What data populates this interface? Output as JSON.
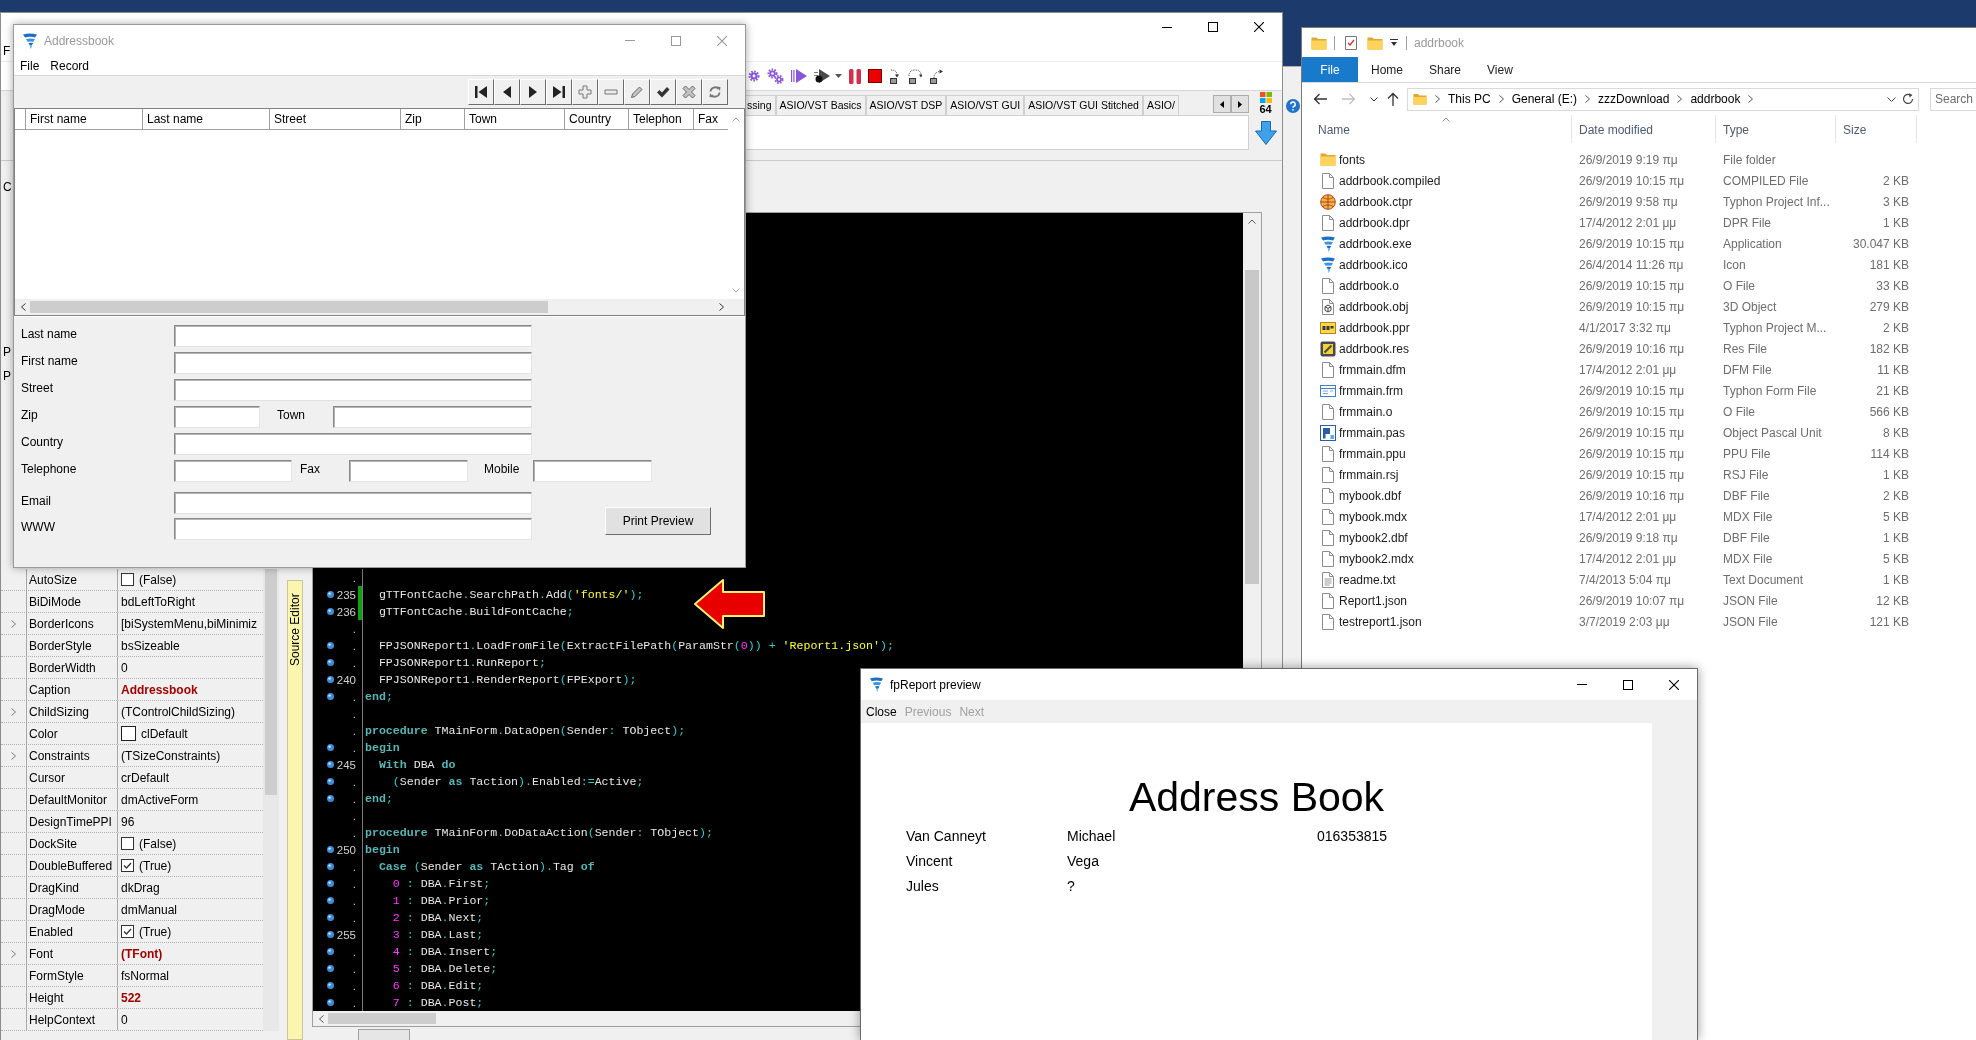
{
  "ide": {
    "menu_fragment": "F",
    "panel_fragments": [
      "C",
      "P",
      "P"
    ],
    "palette_tabs": [
      "ssing",
      "ASIO/VST Basics",
      "ASIO/VST DSP",
      "ASIO/VST GUI",
      "ASIO/VST GUI Stitched",
      "ASIO/"
    ],
    "target_badge": "64",
    "inspector": [
      {
        "name": "AutoSize",
        "value": "(False)",
        "kind": "checkbox",
        "checked": false,
        "expandable": false,
        "modified": false
      },
      {
        "name": "BiDiMode",
        "value": "bdLeftToRight",
        "kind": "text",
        "expandable": false,
        "modified": false
      },
      {
        "name": "BorderIcons",
        "value": "[biSystemMenu,biMinimiz",
        "kind": "text",
        "expandable": true,
        "modified": false
      },
      {
        "name": "BorderStyle",
        "value": "bsSizeable",
        "kind": "text",
        "expandable": false,
        "modified": false
      },
      {
        "name": "BorderWidth",
        "value": "0",
        "kind": "text",
        "expandable": false,
        "modified": false
      },
      {
        "name": "Caption",
        "value": "Addressbook",
        "kind": "text",
        "expandable": false,
        "modified": true
      },
      {
        "name": "ChildSizing",
        "value": "(TControlChildSizing)",
        "kind": "text",
        "expandable": true,
        "modified": false
      },
      {
        "name": "Color",
        "value": "clDefault",
        "kind": "color",
        "expandable": false,
        "modified": false
      },
      {
        "name": "Constraints",
        "value": "(TSizeConstraints)",
        "kind": "text",
        "expandable": true,
        "modified": false
      },
      {
        "name": "Cursor",
        "value": "crDefault",
        "kind": "text",
        "expandable": false,
        "modified": false
      },
      {
        "name": "DefaultMonitor",
        "value": "dmActiveForm",
        "kind": "text",
        "expandable": false,
        "modified": false
      },
      {
        "name": "DesignTimePPI",
        "value": "96",
        "kind": "text",
        "expandable": false,
        "modified": false
      },
      {
        "name": "DockSite",
        "value": "(False)",
        "kind": "checkbox",
        "checked": false,
        "expandable": false,
        "modified": false
      },
      {
        "name": "DoubleBuffered",
        "value": "(True)",
        "kind": "checkbox",
        "checked": true,
        "expandable": false,
        "modified": false
      },
      {
        "name": "DragKind",
        "value": "dkDrag",
        "kind": "text",
        "expandable": false,
        "modified": false
      },
      {
        "name": "DragMode",
        "value": "dmManual",
        "kind": "text",
        "expandable": false,
        "modified": false
      },
      {
        "name": "Enabled",
        "value": "(True)",
        "kind": "checkbox",
        "checked": true,
        "expandable": false,
        "modified": false
      },
      {
        "name": "Font",
        "value": "(TFont)",
        "kind": "text",
        "expandable": true,
        "modified": true
      },
      {
        "name": "FormStyle",
        "value": "fsNormal",
        "kind": "text",
        "expandable": false,
        "modified": false
      },
      {
        "name": "Height",
        "value": "522",
        "kind": "text",
        "expandable": false,
        "modified": true
      },
      {
        "name": "HelpContext",
        "value": "0",
        "kind": "text",
        "expandable": false,
        "modified": false
      }
    ],
    "source_editor_tab": "Source Editor",
    "editor_lines": [
      {
        "number": ".",
        "executable": false,
        "modified": false
      },
      {
        "number": "235",
        "executable": true,
        "modified": true,
        "code": [
          {
            "kind": "id",
            "text": "  gTTFontCache"
          },
          {
            "kind": "sym",
            "text": "."
          },
          {
            "kind": "id",
            "text": "SearchPath"
          },
          {
            "kind": "sym",
            "text": "."
          },
          {
            "kind": "id",
            "text": "Add"
          },
          {
            "kind": "sym",
            "text": "("
          },
          {
            "kind": "str",
            "text": "'fonts/'"
          },
          {
            "kind": "sym",
            "text": ");"
          }
        ]
      },
      {
        "number": "236",
        "executable": true,
        "modified": true,
        "code": [
          {
            "kind": "id",
            "text": "  gTTFontCache"
          },
          {
            "kind": "sym",
            "text": "."
          },
          {
            "kind": "id",
            "text": "BuildFontCache"
          },
          {
            "kind": "sym",
            "text": ";"
          }
        ]
      },
      {
        "number": ".",
        "executable": false,
        "modified": false
      },
      {
        "number": ".",
        "executable": true,
        "modified": false,
        "code": [
          {
            "kind": "id",
            "text": "  FPJSONReport1"
          },
          {
            "kind": "sym",
            "text": "."
          },
          {
            "kind": "id",
            "text": "LoadFromFile"
          },
          {
            "kind": "sym",
            "text": "("
          },
          {
            "kind": "id",
            "text": "ExtractFilePath"
          },
          {
            "kind": "sym",
            "text": "("
          },
          {
            "kind": "id",
            "text": "ParamStr"
          },
          {
            "kind": "sym",
            "text": "("
          },
          {
            "kind": "num",
            "text": "0"
          },
          {
            "kind": "sym",
            "text": ")) + "
          },
          {
            "kind": "str",
            "text": "'Report1.json'"
          },
          {
            "kind": "sym",
            "text": ");"
          }
        ]
      },
      {
        "number": ".",
        "executable": true,
        "modified": false,
        "code": [
          {
            "kind": "id",
            "text": "  FPJSONReport1"
          },
          {
            "kind": "sym",
            "text": "."
          },
          {
            "kind": "id",
            "text": "RunReport"
          },
          {
            "kind": "sym",
            "text": ";"
          }
        ]
      },
      {
        "number": "240",
        "executable": true,
        "modified": false,
        "code": [
          {
            "kind": "id",
            "text": "  FPJSONReport1"
          },
          {
            "kind": "sym",
            "text": "."
          },
          {
            "kind": "id",
            "text": "RenderReport"
          },
          {
            "kind": "sym",
            "text": "("
          },
          {
            "kind": "id",
            "text": "FPExport"
          },
          {
            "kind": "sym",
            "text": ");"
          }
        ]
      },
      {
        "number": ".",
        "executable": true,
        "modified": false,
        "code": [
          {
            "kind": "kw",
            "text": "end"
          },
          {
            "kind": "sym",
            "text": ";"
          }
        ]
      },
      {
        "number": ".",
        "executable": false,
        "modified": false
      },
      {
        "number": ".",
        "executable": false,
        "modified": false,
        "code": [
          {
            "kind": "kw",
            "text": "procedure"
          },
          {
            "kind": "id",
            "text": " TMainForm"
          },
          {
            "kind": "sym",
            "text": "."
          },
          {
            "kind": "id",
            "text": "DataOpen"
          },
          {
            "kind": "sym",
            "text": "("
          },
          {
            "kind": "id",
            "text": "Sender"
          },
          {
            "kind": "sym",
            "text": ": "
          },
          {
            "kind": "id",
            "text": "TObject"
          },
          {
            "kind": "sym",
            "text": ");"
          }
        ]
      },
      {
        "number": ".",
        "executable": true,
        "modified": false,
        "code": [
          {
            "kind": "kw",
            "text": "begin"
          }
        ]
      },
      {
        "number": "245",
        "executable": true,
        "modified": false,
        "code": [
          {
            "kind": "kw",
            "text": "  With"
          },
          {
            "kind": "id",
            "text": " DBA "
          },
          {
            "kind": "kw",
            "text": "do"
          }
        ]
      },
      {
        "number": ".",
        "executable": true,
        "modified": false,
        "code": [
          {
            "kind": "sym",
            "text": "    ("
          },
          {
            "kind": "id",
            "text": "Sender "
          },
          {
            "kind": "kw",
            "text": "as"
          },
          {
            "kind": "id",
            "text": " Taction"
          },
          {
            "kind": "sym",
            "text": ")."
          },
          {
            "kind": "id",
            "text": "Enabled"
          },
          {
            "kind": "sym",
            "text": ":="
          },
          {
            "kind": "id",
            "text": "Active"
          },
          {
            "kind": "sym",
            "text": ";"
          }
        ]
      },
      {
        "number": ".",
        "executable": true,
        "modified": false,
        "code": [
          {
            "kind": "kw",
            "text": "end"
          },
          {
            "kind": "sym",
            "text": ";"
          }
        ]
      },
      {
        "number": ".",
        "executable": false,
        "modified": false
      },
      {
        "number": ".",
        "executable": false,
        "modified": false,
        "code": [
          {
            "kind": "kw",
            "text": "procedure"
          },
          {
            "kind": "id",
            "text": " TMainForm"
          },
          {
            "kind": "sym",
            "text": "."
          },
          {
            "kind": "id",
            "text": "DoDataAction"
          },
          {
            "kind": "sym",
            "text": "("
          },
          {
            "kind": "id",
            "text": "Sender"
          },
          {
            "kind": "sym",
            "text": ": "
          },
          {
            "kind": "id",
            "text": "TObject"
          },
          {
            "kind": "sym",
            "text": ");"
          }
        ]
      },
      {
        "number": "250",
        "executable": true,
        "modified": false,
        "code": [
          {
            "kind": "kw",
            "text": "begin"
          }
        ]
      },
      {
        "number": ".",
        "executable": true,
        "modified": false,
        "code": [
          {
            "kind": "kw",
            "text": "  Case"
          },
          {
            "kind": "sym",
            "text": " ("
          },
          {
            "kind": "id",
            "text": "Sender "
          },
          {
            "kind": "kw",
            "text": "as"
          },
          {
            "kind": "id",
            "text": " TAction"
          },
          {
            "kind": "sym",
            "text": ")."
          },
          {
            "kind": "id",
            "text": "Tag "
          },
          {
            "kind": "kw",
            "text": "of"
          }
        ]
      },
      {
        "number": ".",
        "executable": true,
        "modified": false,
        "code": [
          {
            "kind": "num",
            "text": "    0"
          },
          {
            "kind": "sym",
            "text": " : "
          },
          {
            "kind": "id",
            "text": "DBA"
          },
          {
            "kind": "sym",
            "text": "."
          },
          {
            "kind": "id",
            "text": "First"
          },
          {
            "kind": "sym",
            "text": ";"
          }
        ]
      },
      {
        "number": ".",
        "executable": true,
        "modified": false,
        "code": [
          {
            "kind": "num",
            "text": "    1"
          },
          {
            "kind": "sym",
            "text": " : "
          },
          {
            "kind": "id",
            "text": "DBA"
          },
          {
            "kind": "sym",
            "text": "."
          },
          {
            "kind": "id",
            "text": "Prior"
          },
          {
            "kind": "sym",
            "text": ";"
          }
        ]
      },
      {
        "number": ".",
        "executable": true,
        "modified": false,
        "code": [
          {
            "kind": "num",
            "text": "    2"
          },
          {
            "kind": "sym",
            "text": " : "
          },
          {
            "kind": "id",
            "text": "DBA"
          },
          {
            "kind": "sym",
            "text": "."
          },
          {
            "kind": "id",
            "text": "Next"
          },
          {
            "kind": "sym",
            "text": ";"
          }
        ]
      },
      {
        "number": "255",
        "executable": true,
        "modified": false,
        "code": [
          {
            "kind": "num",
            "text": "    3"
          },
          {
            "kind": "sym",
            "text": " : "
          },
          {
            "kind": "id",
            "text": "DBA"
          },
          {
            "kind": "sym",
            "text": "."
          },
          {
            "kind": "id",
            "text": "Last"
          },
          {
            "kind": "sym",
            "text": ";"
          }
        ]
      },
      {
        "number": ".",
        "executable": true,
        "modified": false,
        "code": [
          {
            "kind": "num",
            "text": "    4"
          },
          {
            "kind": "sym",
            "text": " : "
          },
          {
            "kind": "id",
            "text": "DBA"
          },
          {
            "kind": "sym",
            "text": "."
          },
          {
            "kind": "id",
            "text": "Insert"
          },
          {
            "kind": "sym",
            "text": ";"
          }
        ]
      },
      {
        "number": ".",
        "executable": true,
        "modified": false,
        "code": [
          {
            "kind": "num",
            "text": "    5"
          },
          {
            "kind": "sym",
            "text": " : "
          },
          {
            "kind": "id",
            "text": "DBA"
          },
          {
            "kind": "sym",
            "text": "."
          },
          {
            "kind": "id",
            "text": "Delete"
          },
          {
            "kind": "sym",
            "text": ";"
          }
        ]
      },
      {
        "number": ".",
        "executable": true,
        "modified": false,
        "code": [
          {
            "kind": "num",
            "text": "    6"
          },
          {
            "kind": "sym",
            "text": " : "
          },
          {
            "kind": "id",
            "text": "DBA"
          },
          {
            "kind": "sym",
            "text": "."
          },
          {
            "kind": "id",
            "text": "Edit"
          },
          {
            "kind": "sym",
            "text": ";"
          }
        ]
      },
      {
        "number": ".",
        "executable": true,
        "modified": false,
        "code": [
          {
            "kind": "num",
            "text": "    7"
          },
          {
            "kind": "sym",
            "text": " : "
          },
          {
            "kind": "id",
            "text": "DBA"
          },
          {
            "kind": "sym",
            "text": "."
          },
          {
            "kind": "id",
            "text": "Post"
          },
          {
            "kind": "sym",
            "text": ";"
          }
        ]
      }
    ]
  },
  "addressbook": {
    "title": "Addressbook",
    "active": false,
    "menu": [
      "File",
      "Record"
    ],
    "grid_columns": [
      "First name",
      "Last name",
      "Street",
      "Zip",
      "Town",
      "Country",
      "Telephon",
      "Fax"
    ],
    "rows": [
      [
        "Last name"
      ],
      [
        "First name"
      ],
      [
        "Street"
      ],
      [
        "Zip",
        "Town"
      ],
      [
        "Country"
      ],
      [
        "Telephone",
        "Fax",
        "Mobile"
      ]
    ],
    "contact_rows": [
      "Email",
      "WWW"
    ],
    "print_button": "Print Preview"
  },
  "explorer": {
    "title": "addrbook",
    "active": false,
    "ribbon_tabs": [
      {
        "label": "File",
        "kind": "menu"
      },
      {
        "label": "Home",
        "kind": "tab"
      },
      {
        "label": "Share",
        "kind": "tab"
      },
      {
        "label": "View",
        "kind": "tab"
      }
    ],
    "nav_buttons": [
      {
        "kind": "back",
        "disabled": false
      },
      {
        "kind": "forward",
        "disabled": true
      },
      {
        "kind": "recent",
        "disabled": false
      },
      {
        "kind": "up",
        "disabled": false
      }
    ],
    "breadcrumb": [
      "This PC",
      "General (E:)",
      "zzzDownload",
      "addrbook"
    ],
    "search_placeholder": "Search",
    "columns": [
      "Name",
      "Date modified",
      "Type",
      "Size"
    ],
    "files": [
      {
        "name": "fonts",
        "date": "26/9/2019 9:19 πμ",
        "type": "File folder",
        "kind": "folder"
      },
      {
        "name": "addrbook.compiled",
        "date": "26/9/2019 10:15 πμ",
        "type": "COMPILED File",
        "size": "2 KB",
        "kind": "file"
      },
      {
        "name": "addrbook.ctpr",
        "date": "26/9/2019 9:58 πμ",
        "type": "Typhon Project Inf...",
        "size": "3 KB",
        "kind": "project"
      },
      {
        "name": "addrbook.dpr",
        "date": "17/4/2012 2:01 μμ",
        "type": "DPR File",
        "size": "1 KB",
        "kind": "file"
      },
      {
        "name": "addrbook.exe",
        "date": "26/9/2019 10:15 πμ",
        "type": "Application",
        "size": "30.047 KB",
        "kind": "typhon"
      },
      {
        "name": "addrbook.ico",
        "date": "26/4/2014 11:26 πμ",
        "type": "Icon",
        "size": "181 KB",
        "kind": "typhon"
      },
      {
        "name": "addrbook.o",
        "date": "26/9/2019 10:15 πμ",
        "type": "O File",
        "size": "33 KB",
        "kind": "file"
      },
      {
        "name": "addrbook.obj",
        "date": "26/9/2019 10:15 πμ",
        "type": "3D Object",
        "size": "279 KB",
        "kind": "object3d"
      },
      {
        "name": "addrbook.ppr",
        "date": "4/1/2017 3:32 πμ",
        "type": "Typhon Project M...",
        "size": "2 KB",
        "kind": "ppr"
      },
      {
        "name": "addrbook.res",
        "date": "26/9/2019 10:16 πμ",
        "type": "Res File",
        "size": "182 KB",
        "kind": "res"
      },
      {
        "name": "frmmain.dfm",
        "date": "17/4/2012 2:01 μμ",
        "type": "DFM File",
        "size": "11 KB",
        "kind": "file"
      },
      {
        "name": "frmmain.frm",
        "date": "26/9/2019 10:15 πμ",
        "type": "Typhon Form File",
        "size": "21 KB",
        "kind": "form"
      },
      {
        "name": "frmmain.o",
        "date": "26/9/2019 10:15 πμ",
        "type": "O File",
        "size": "566 KB",
        "kind": "file"
      },
      {
        "name": "frmmain.pas",
        "date": "26/9/2019 10:15 πμ",
        "type": "Object Pascal Unit",
        "size": "8 KB",
        "kind": "pascal"
      },
      {
        "name": "frmmain.ppu",
        "date": "26/9/2019 10:15 πμ",
        "type": "PPU File",
        "size": "114 KB",
        "kind": "file"
      },
      {
        "name": "frmmain.rsj",
        "date": "26/9/2019 10:15 πμ",
        "type": "RSJ File",
        "size": "1 KB",
        "kind": "file"
      },
      {
        "name": "mybook.dbf",
        "date": "26/9/2019 10:16 πμ",
        "type": "DBF File",
        "size": "2 KB",
        "kind": "file"
      },
      {
        "name": "mybook.mdx",
        "date": "17/4/2012 2:01 μμ",
        "type": "MDX File",
        "size": "5 KB",
        "kind": "file"
      },
      {
        "name": "mybook2.dbf",
        "date": "26/9/2019 9:18 πμ",
        "type": "DBF File",
        "size": "1 KB",
        "kind": "file"
      },
      {
        "name": "mybook2.mdx",
        "date": "17/4/2012 2:01 μμ",
        "type": "MDX File",
        "size": "5 KB",
        "kind": "file"
      },
      {
        "name": "readme.txt",
        "date": "7/4/2013 5:04 πμ",
        "type": "Text Document",
        "size": "1 KB",
        "kind": "text"
      },
      {
        "name": "Report1.json",
        "date": "26/9/2019 10:07 πμ",
        "type": "JSON File",
        "size": "12 KB",
        "kind": "file"
      },
      {
        "name": "testreport1.json",
        "date": "3/7/2019 2:03 μμ",
        "type": "JSON File",
        "size": "121 KB",
        "kind": "file"
      }
    ]
  },
  "report_preview": {
    "title": "fpReport preview",
    "active": true,
    "toolbar": [
      {
        "label": "Close",
        "disabled": false
      },
      {
        "label": "Previous",
        "disabled": true
      },
      {
        "label": "Next",
        "disabled": true
      }
    ],
    "heading": "Address Book",
    "rows": [
      {
        "column_1": "Van Canneyt",
        "column_2": "Michael",
        "column_3": "016353815"
      },
      {
        "column_1": "Vincent",
        "column_2": "Vega"
      },
      {
        "column_1": "Jules",
        "column_2": "?"
      }
    ]
  }
}
